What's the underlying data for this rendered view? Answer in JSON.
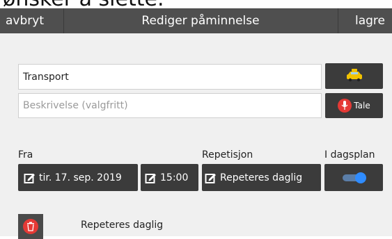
{
  "caption": "ønsker å slette.",
  "header": {
    "cancel_label": "avbryt",
    "title": "Rediger påminnelse",
    "save_label": "lagre"
  },
  "form": {
    "title_value": "Transport",
    "description_placeholder": "Beskrivelse (valgfritt)",
    "voice_label": "Tale",
    "category_icon": "taxi-icon"
  },
  "labels": {
    "from": "Fra",
    "repetition": "Repetisjon",
    "in_dayplan": "I dagsplan"
  },
  "values": {
    "date": "tir. 17. sep. 2019",
    "time": "15:00",
    "repeat": "Repeteres daglig",
    "in_dayplan_on": true
  },
  "footer": {
    "repeat_text": "Repeteres daglig"
  },
  "colors": {
    "topbar": "#4f4f4f",
    "button": "#3b3b3b",
    "accent_red": "#e53935",
    "toggle_blue": "#2f8cff",
    "taxi_yellow": "#f2c200"
  }
}
